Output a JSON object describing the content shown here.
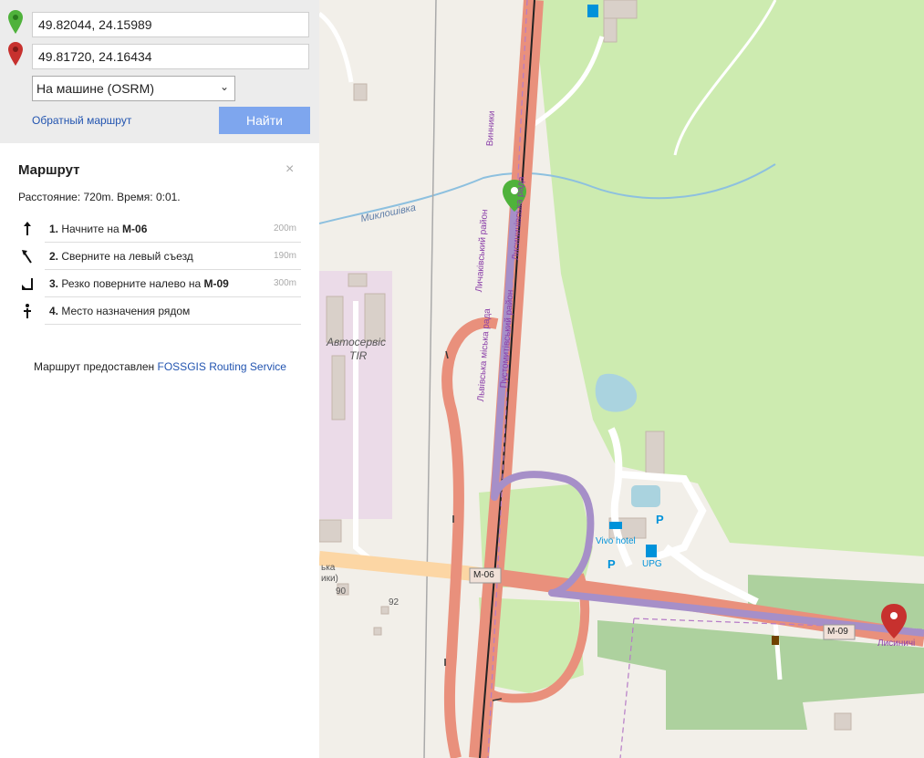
{
  "form": {
    "from_value": "49.82044, 24.15989",
    "to_value": "49.81720, 24.16434",
    "engine_selected": "На машине (OSRM)",
    "reverse_label": "Обратный маршрут",
    "find_label": "Найти"
  },
  "route": {
    "title": "Маршрут",
    "close_glyph": "×",
    "summary": "Расстояние: 720m. Время: 0:01.",
    "steps": [
      {
        "num": "1.",
        "text": "Начните на ",
        "bold": "M-06",
        "dist": "200m"
      },
      {
        "num": "2.",
        "text": "Сверните на левый съезд",
        "bold": "",
        "dist": "190m"
      },
      {
        "num": "3.",
        "text": "Резко поверните налево на ",
        "bold": "M-09",
        "dist": "300m"
      },
      {
        "num": "4.",
        "text": "Место назначения рядом",
        "bold": "",
        "dist": ""
      }
    ],
    "attribution_prefix": "Маршрут предоставлен ",
    "attribution_link": "FOSSGIS Routing Service"
  },
  "map": {
    "labels": {
      "stream": "Миклошівка",
      "autoservice_line1": "Автосервіс",
      "autoservice_line2": "TIR",
      "vynnyky": "Винники",
      "rada1": "Личаківський район",
      "rada2": "Лисиничівська рада",
      "rada3": "Львівська міська рада",
      "rada4": "Пустомитівський район",
      "road_m06": "M-06",
      "road_m09": "M-09",
      "vivo_hotel": "Vivo hotel",
      "upg": "UPG",
      "house_90": "90",
      "house_92": "92",
      "parking": "P",
      "left_partial1": "ька",
      "left_partial2": "ики)",
      "lysynychi": "Лисиничі"
    }
  },
  "colors": {
    "start_marker": "#4fb23b",
    "end_marker": "#c7312e",
    "route": "#a68fc8",
    "trunk_road": "#e9907c",
    "find_button": "#7ea6ee",
    "link": "#2254b0"
  }
}
